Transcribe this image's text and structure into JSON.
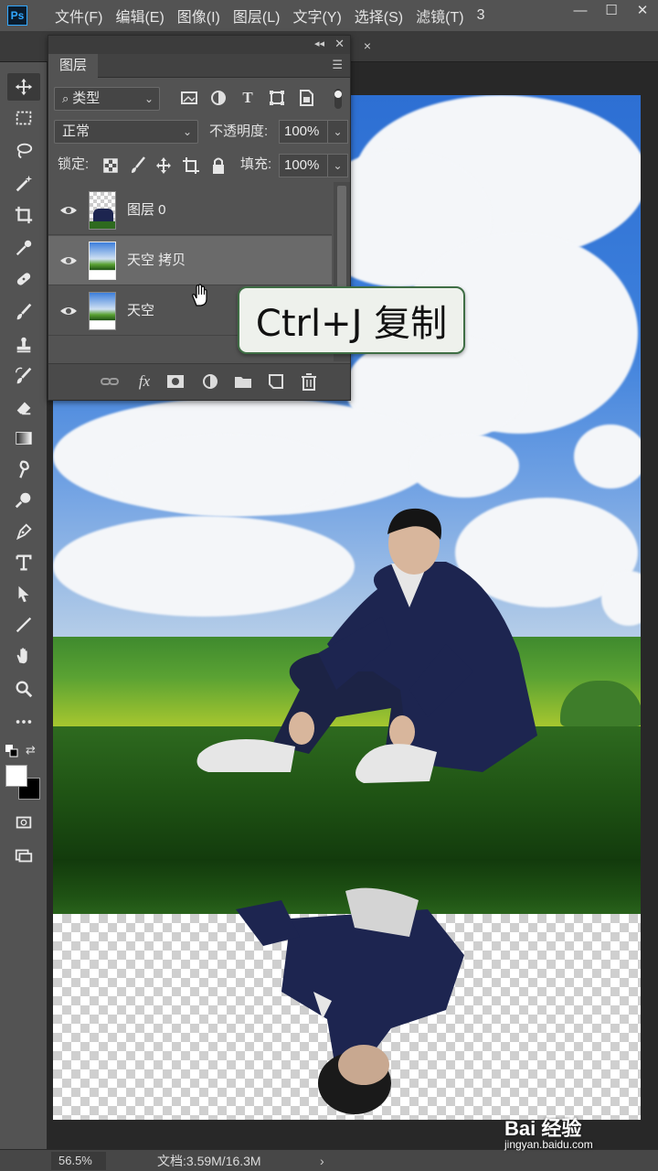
{
  "app": {
    "logo": "Ps"
  },
  "menu": [
    "文件(F)",
    "编辑(E)",
    "图像(I)",
    "图层(L)",
    "文字(Y)",
    "选择(S)",
    "滤镜(T)",
    "3"
  ],
  "window_controls": {
    "minimize": "—",
    "maximize": "☐",
    "close": "✕"
  },
  "document_tab": {
    "close": "×"
  },
  "toolbar": {
    "grip": "▸▸",
    "tools": [
      "move-icon",
      "marquee-icon",
      "lasso-icon",
      "magic-wand-icon",
      "crop-icon",
      "eyedropper-icon",
      "healing-brush-icon",
      "brush-icon",
      "clone-stamp-icon",
      "history-brush-icon",
      "eraser-icon",
      "gradient-icon",
      "smudge-icon",
      "dodge-icon",
      "pen-icon",
      "type-icon",
      "path-selection-icon",
      "line-icon",
      "hand-icon",
      "zoom-icon",
      "more-tools-icon"
    ],
    "foreground_color": "#ffffff",
    "background_color": "#000000",
    "bottom_tools": [
      "quick-mask-icon",
      "screen-mode-icon"
    ]
  },
  "layers_panel": {
    "tab_label": "图层",
    "filter_kind": "类型",
    "blend_mode": "正常",
    "opacity_label": "不透明度:",
    "opacity_value": "100%",
    "lock_label": "锁定:",
    "fill_label": "填充:",
    "fill_value": "100%",
    "layers": [
      {
        "name": "图层 0",
        "visible": true,
        "selected": false
      },
      {
        "name": "天空 拷贝",
        "visible": true,
        "selected": true
      },
      {
        "name": "天空",
        "visible": true,
        "selected": false
      }
    ],
    "footer_icons": [
      "link-icon",
      "fx-icon",
      "mask-icon",
      "adjustment-icon",
      "group-icon",
      "new-layer-icon",
      "trash-icon"
    ],
    "fx_label": "fx"
  },
  "tooltip": {
    "text": "Ctrl+J 复制"
  },
  "status_bar": {
    "zoom": "56.5%",
    "doc_info": "文档:3.59M/16.3M",
    "arrow": "›"
  },
  "watermark": {
    "logo": "Bai 经验",
    "url": "jingyan.baidu.com"
  }
}
